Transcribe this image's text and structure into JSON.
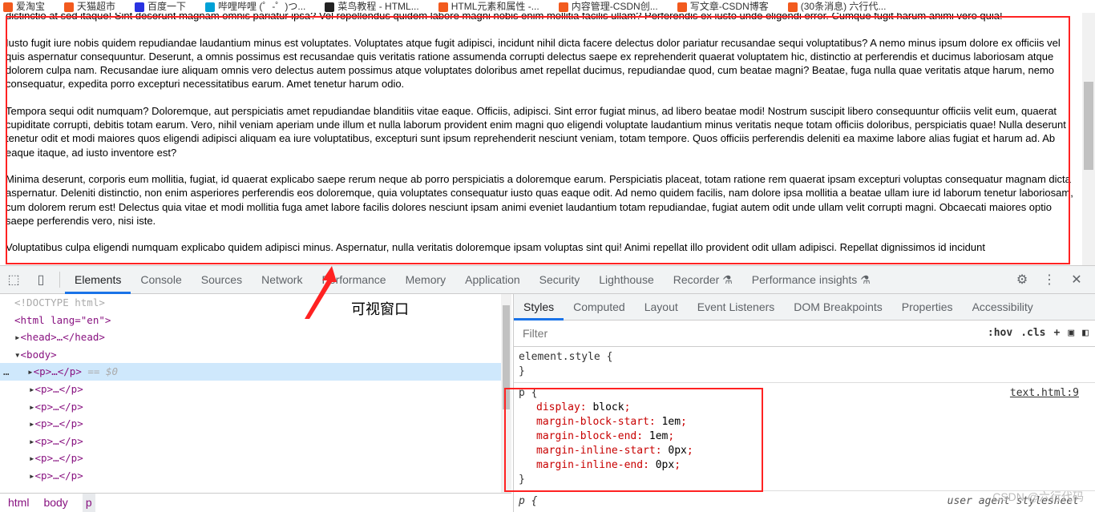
{
  "bookmarks": [
    "爱淘宝",
    "天猫超市",
    "百度一下",
    "哔哩哔哩 (゜-゜)つ...",
    "菜鸟教程 - HTML...",
    "HTML元素和属性 -...",
    "内容管理-CSDN创...",
    "写文章-CSDN博客",
    "(30条消息) 六行代..."
  ],
  "page": {
    "paragraphs": [
      "Ipsam inventore, totam perspiciatis nobis repudiandae magni eveniet dolores maxime, voluptatem aliquam ipsum quaerat enim velit, quos repellendus non delectus, esse nisi ullam tempora nam ea atque, soluta voluptate quas minus distinctio at sed itaque! Sint deserunt magnam omnis pariatur ipsa? Vel repellendus quidem labore magni nobis enim mollitia facilis ullam? Perferendis ex iusto unde eligendi error. Cumque fugit harum animi vero quia!",
      "Iusto fugit iure nobis quidem repudiandae laudantium minus est voluptates. Voluptates atque fugit adipisci, incidunt nihil dicta facere delectus dolor pariatur recusandae sequi voluptatibus? A nemo minus ipsum dolore ex officiis vel quis aspernatur consequuntur. Deserunt, a omnis possimus est recusandae quis veritatis ratione assumenda corrupti delectus saepe ex reprehenderit quaerat voluptatem hic, distinctio at perferendis et ducimus laboriosam atque dolorem culpa nam. Recusandae iure aliquam omnis vero delectus autem possimus atque voluptates doloribus amet repellat ducimus, repudiandae quod, cum beatae magni? Beatae, fuga nulla quae veritatis atque harum, nemo consequatur, expedita porro excepturi necessitatibus earum. Amet tenetur harum odio.",
      "Tempora sequi odit numquam? Doloremque, aut perspiciatis amet repudiandae blanditiis vitae eaque. Officiis, adipisci. Sint error fugiat minus, ad libero beatae modi! Nostrum suscipit libero consequuntur officiis velit eum, quaerat cupiditate corrupti, debitis totam earum. Vero, nihil veniam aperiam unde illum et nulla laborum provident enim magni quo eligendi voluptate laudantium minus veritatis neque totam officiis doloribus, perspiciatis quae! Nulla deserunt tenetur odit et modi maiores quos eligendi adipisci aliquam ea iure voluptatibus, excepturi sunt ipsum reprehenderit nesciunt veniam, totam tempore. Quos officiis perferendis deleniti ea maxime labore alias fugiat et harum ad. Ab eaque itaque, ad iusto inventore est?",
      "Minima deserunt, corporis eum mollitia, fugiat, id quaerat explicabo saepe rerum neque ab porro perspiciatis a doloremque earum. Perspiciatis placeat, totam ratione rem quaerat ipsam excepturi voluptas consequatur magnam dicta aspernatur. Deleniti distinctio, non enim asperiores perferendis eos doloremque, quia voluptates consequatur iusto quas eaque odit. Ad nemo quidem facilis, nam dolore ipsa mollitia a beatae ullam iure id laborum tenetur laboriosam, cum dolorem rerum est! Delectus quia vitae et modi mollitia fuga amet labore facilis dolores nesciunt ipsam animi eveniet laudantium totam repudiandae, fugiat autem odit unde ullam velit corrupti magni. Obcaecati maiores optio saepe perferendis vero, nisi iste.",
      "Voluptatibus culpa eligendi numquam explicabo quidem adipisci minus. Aspernatur, nulla veritatis doloremque ipsam voluptas sint qui! Animi repellat illo provident odit ullam adipisci. Repellat dignissimos id incidunt"
    ]
  },
  "annotation": "可视窗口",
  "devtools": {
    "tabs": [
      "Elements",
      "Console",
      "Sources",
      "Network",
      "Performance",
      "Memory",
      "Application",
      "Security",
      "Lighthouse",
      "Recorder ⚗",
      "Performance insights ⚗"
    ],
    "dom": {
      "doctype": "<!DOCTYPE html>",
      "html": "<html lang=\"en\">",
      "head": "<head>…</head>",
      "body": "<body>",
      "p": "<p>…</p>",
      "selected_suffix": " == $0"
    },
    "breadcrumbs": [
      "html",
      "body",
      "p"
    ],
    "style_tabs": [
      "Styles",
      "Computed",
      "Layout",
      "Event Listeners",
      "DOM Breakpoints",
      "Properties",
      "Accessibility"
    ],
    "filter_placeholder": "Filter",
    "hov": ":hov",
    "cls": ".cls",
    "element_style": "element.style {",
    "rule_selector": "p {",
    "rule_source": "text.html:9",
    "declarations": [
      [
        "display",
        "block"
      ],
      [
        "margin-block-start",
        "1em"
      ],
      [
        "margin-block-end",
        "1em"
      ],
      [
        "margin-inline-start",
        "0px"
      ],
      [
        "margin-inline-end",
        "0px"
      ]
    ],
    "next_selector": "p {",
    "next_source": "user agent stylesheet"
  },
  "watermark": "CSDN @六行代码"
}
